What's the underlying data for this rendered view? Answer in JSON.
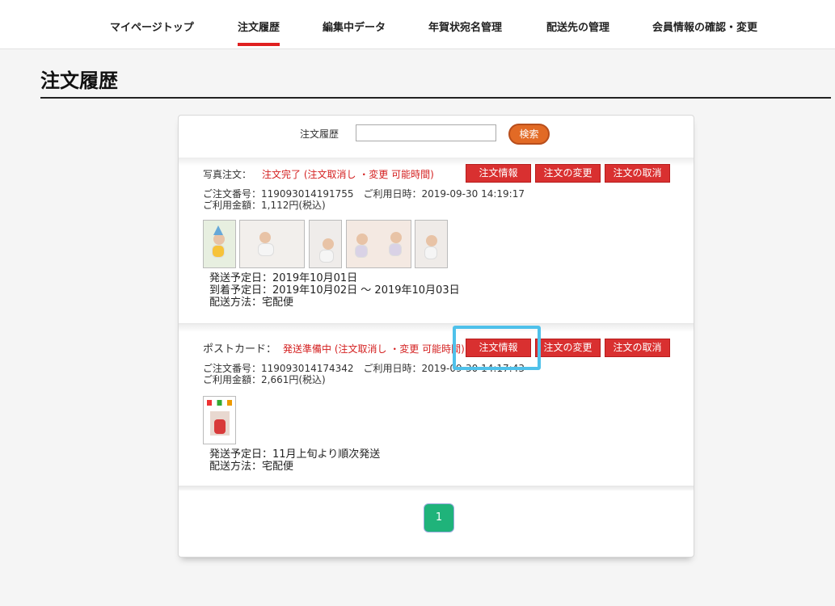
{
  "nav": {
    "items": [
      "マイページトップ",
      "注文履歴",
      "編集中データ",
      "年賀状宛名管理",
      "配送先の管理",
      "会員情報の確認・変更"
    ]
  },
  "page": {
    "title": "注文履歴"
  },
  "search": {
    "label": "注文履歴",
    "value": "",
    "button": "検索"
  },
  "orders": [
    {
      "type": "写真注文：",
      "status": "注文完了 (注文取消し ・変更 可能時間)",
      "buttons": [
        "注文情報",
        "注文の変更",
        "注文の取消"
      ],
      "order_number": "ご注文番号：119093014191755　ご利用日時：2019-09-30 14:19:17",
      "amount": "ご利用金額：1,112円(税込)",
      "ship_date": "発送予定日：2019年10月01日",
      "arrival": "到着予定日：2019年10月02日 ～ 2019年10月03日",
      "method": "配送方法：宅配便"
    },
    {
      "type": "ポストカード：",
      "status": "発送準備中 (注文取消し ・変更 可能時間)",
      "buttons": [
        "注文情報",
        "注文の変更",
        "注文の取消"
      ],
      "order_number": "ご注文番号：119093014174342　ご利用日時：2019-09-30 14:17:43",
      "amount": "ご利用金額：2,661円(税込)",
      "ship_date": "発送予定日：11月上旬より順次発送",
      "method": "配送方法：宅配便"
    }
  ],
  "pagination": {
    "current": "1"
  },
  "colors": {
    "accent": "#e02020",
    "button_red": "#d93030",
    "search_orange": "#e26a25",
    "pager_green": "#1fb37a",
    "highlight": "#4fc1ea"
  }
}
